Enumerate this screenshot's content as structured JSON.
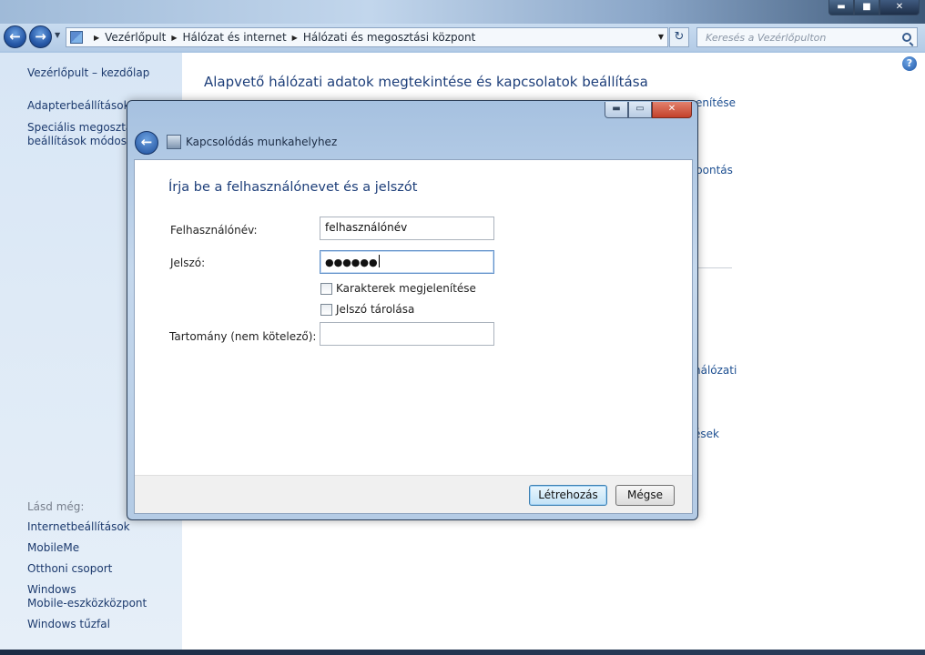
{
  "window": {
    "caption": {
      "minimize": "▬",
      "maximize": "■",
      "close": "✕"
    }
  },
  "navbar": {
    "back_glyph": "←",
    "forward_glyph": "→",
    "breadcrumb": [
      "Vezérlőpult",
      "Hálózat és internet",
      "Hálózati és megosztási központ"
    ],
    "refresh_glyph": "↻",
    "search_placeholder": "Keresés a Vezérlőpulton"
  },
  "left_pane": {
    "home_link": "Vezérlőpult – kezdőlap",
    "links": [
      "Adapterbeállítások m",
      "Speciális megosztási",
      "beállítások módosíta"
    ],
    "see_also_title": "Lásd még:",
    "see_also": [
      "Internetbeállítások",
      "MobileMe",
      "Otthoni csoport",
      "Windows",
      "Mobile-eszközközpont",
      "Windows tűzfal"
    ]
  },
  "main_pane": {
    "heading": "Alapvető hálózati adatok megtekintése és kapcsolatok beállítása",
    "help_glyph": "?",
    "peek_texts": [
      "enítése",
      "bontás",
      "nálózati",
      "ések"
    ]
  },
  "dialog": {
    "title": "Kapcsolódás munkahelyhez",
    "caption": {
      "minimize": "▬",
      "maximize": "▭",
      "close": "✕"
    },
    "back_glyph": "←",
    "heading": "Írja be a felhasználónevet és a jelszót",
    "username_label": "Felhasználónév:",
    "username_value": "felhasználónév",
    "password_label": "Jelszó:",
    "password_value": "●●●●●●",
    "show_chars_label": "Karakterek megjelenítése",
    "show_chars_checked": false,
    "remember_label": "Jelszó tárolása",
    "remember_checked": false,
    "domain_label": "Tartomány (nem kötelező):",
    "domain_value": "",
    "create_button": "Létrehozás",
    "cancel_button": "Mégse"
  }
}
